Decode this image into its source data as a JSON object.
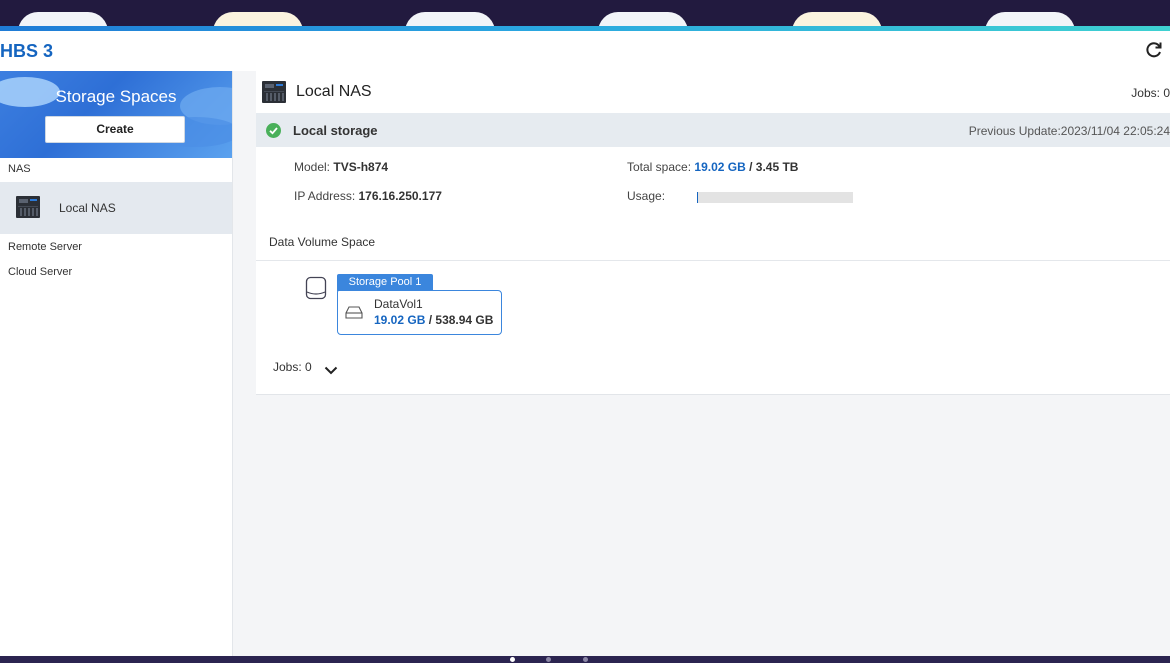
{
  "app": {
    "title": "HBS 3"
  },
  "sidebar": {
    "banner_title": "Storage Spaces",
    "create_label": "Create",
    "nas_section": "NAS",
    "local_nas": "Local NAS",
    "remote_server": "Remote Server",
    "cloud_server": "Cloud Server"
  },
  "main": {
    "title": "Local NAS",
    "jobs_top": "Jobs: 0",
    "storage_title": "Local storage",
    "previous_update": "Previous Update:2023/11/04 22:05:24",
    "model_label": "Model:",
    "model_value": "TVS-h874",
    "ip_label": "IP Address:",
    "ip_value": "176.16.250.177",
    "total_space_label": "Total space:",
    "total_space_used": "19.02 GB",
    "total_space_sep": " / ",
    "total_space_total": "3.45 TB",
    "usage_label": "Usage:",
    "usage_fraction": 0.006,
    "data_volume_label": "Data Volume Space",
    "pool_name": "Storage Pool 1",
    "volume_name": "DataVol1",
    "volume_used": "19.02 GB",
    "volume_sep": " / ",
    "volume_total": "538.94 GB",
    "jobs_bottom": "Jobs: 0"
  },
  "colors": {
    "accent": "#1565c0",
    "pool_blue": "#3b86dd",
    "success_green": "#49b05a"
  },
  "icons": [
    "refresh-icon",
    "nas-device-icon",
    "check-circle-icon",
    "storage-pool-icon",
    "disk-icon",
    "chevron-down-icon"
  ]
}
